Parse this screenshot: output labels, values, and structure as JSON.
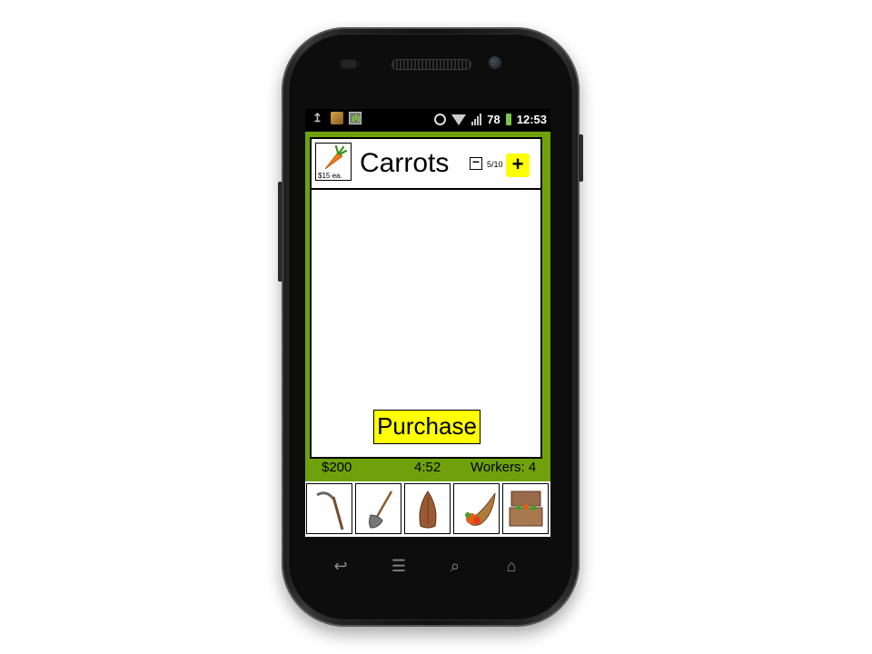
{
  "status_bar": {
    "icons": [
      "upload-icon",
      "flash-icon",
      "chart-icon",
      "sync-icon",
      "wifi-icon",
      "signal-icon",
      "battery-icon"
    ],
    "battery": "78",
    "time": "12:53"
  },
  "item": {
    "name": "Carrots",
    "price": "$15 ea.",
    "quantity": "5/10",
    "icon": "carrot-icon"
  },
  "purchase_label": "Purchase",
  "footer": {
    "money": "$200",
    "timer": "4:52",
    "workers": "Workers: 4"
  },
  "tools": [
    "scythe-icon",
    "shovel-icon",
    "seed-icon",
    "cornucopia-icon",
    "crate-icon"
  ],
  "colors": {
    "app_background": "#6fa20a",
    "highlight": "#ffff00",
    "card": "#ffffff"
  }
}
